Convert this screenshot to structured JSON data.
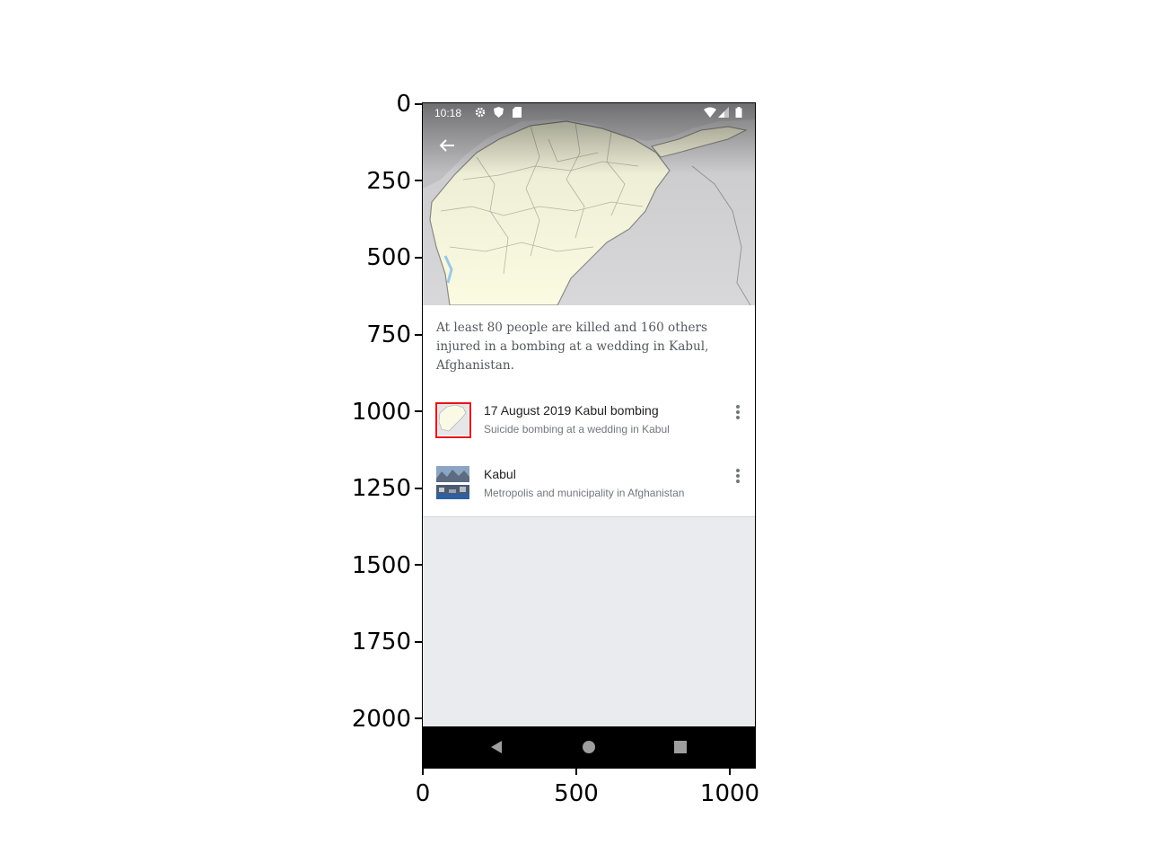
{
  "axes": {
    "y_ticks": [
      "0",
      "250",
      "500",
      "750",
      "1000",
      "1250",
      "1500",
      "1750",
      "2000"
    ],
    "x_ticks": [
      "0",
      "500",
      "1000"
    ]
  },
  "status_bar": {
    "time": "10:18",
    "left_icons": [
      "gear-icon",
      "shield-icon",
      "sd-card-icon"
    ],
    "right_icons": [
      "wifi-icon",
      "signal-icon",
      "battery-icon"
    ]
  },
  "header": {
    "back_icon": "arrow-left-icon"
  },
  "summary": "At least 80 people are killed and 160 others injured in a bombing at a wedding in Kabul, Afghanistan.",
  "articles": [
    {
      "title": "17 August 2019 Kabul bombing",
      "description": "Suicide bombing at a wedding in Kabul",
      "menu_icon": "more-vert-icon"
    },
    {
      "title": "Kabul",
      "description": "Metropolis and municipality in Afghanistan",
      "menu_icon": "more-vert-icon"
    }
  ],
  "nav_bar": [
    "back-triangle-icon",
    "home-circle-icon",
    "recents-square-icon"
  ],
  "colors": {
    "highlight": "#e8141a",
    "page_background": "#eaebee",
    "map_land": "#fbfbe2",
    "map_outside": "#d8d8da"
  }
}
